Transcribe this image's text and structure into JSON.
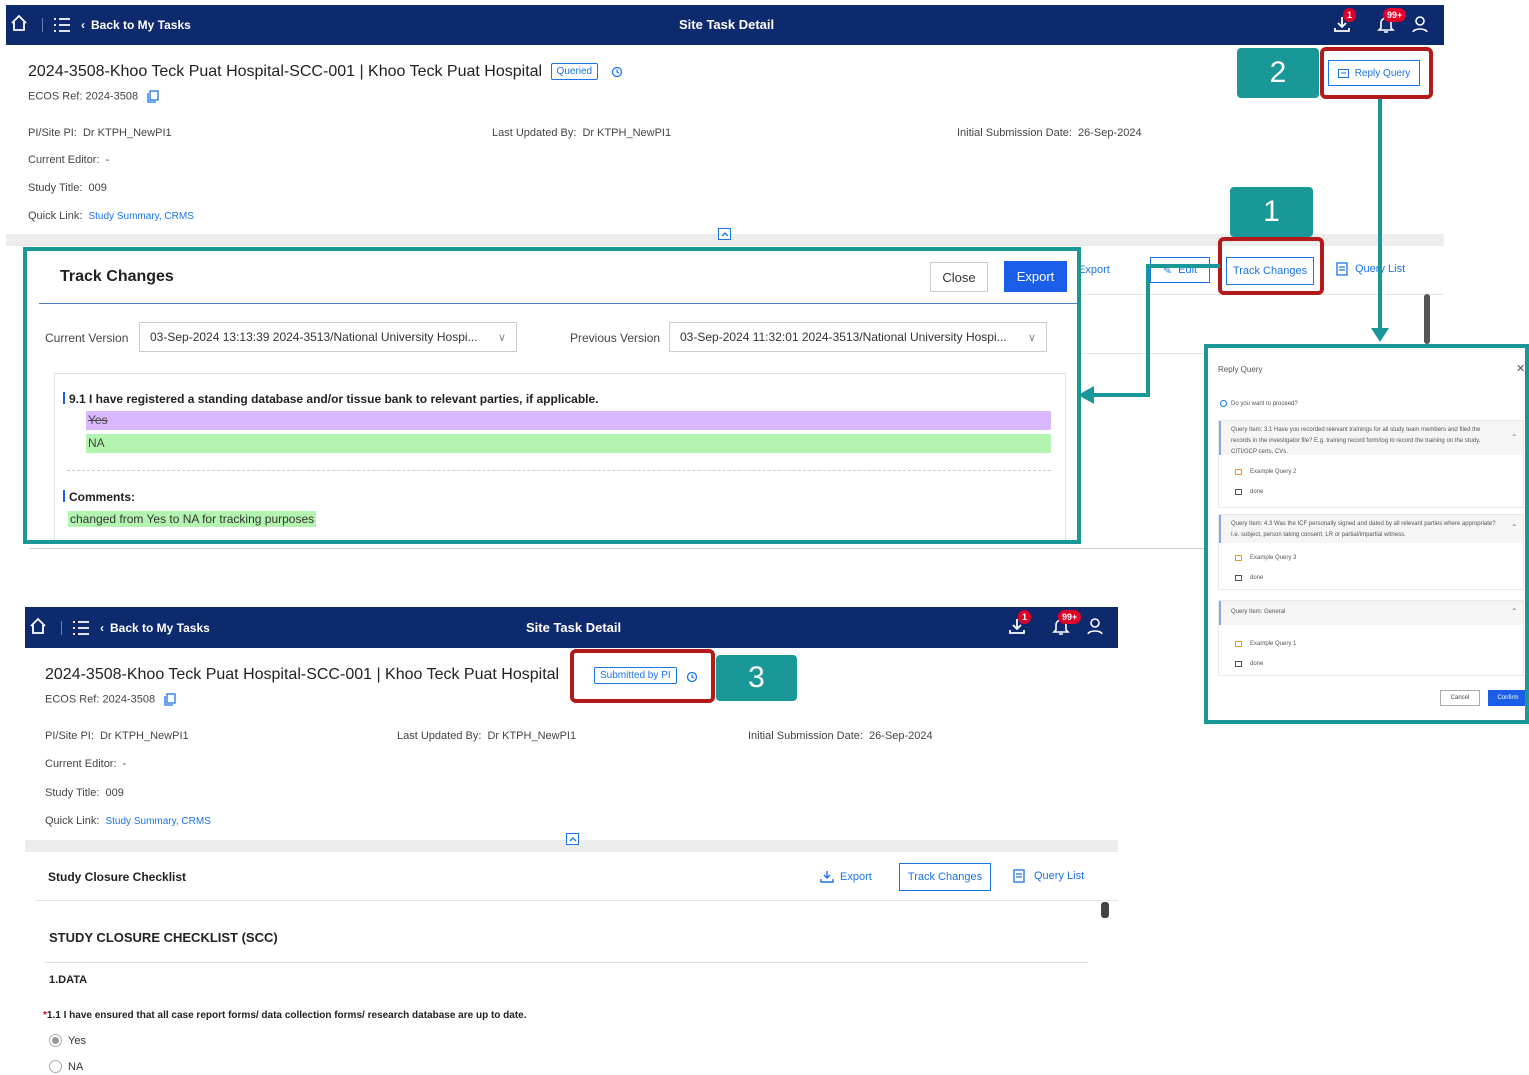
{
  "top_screen": {
    "nav": {
      "back_label": "Back to My Tasks",
      "title": "Site Task Detail",
      "download_badge": "1",
      "bell_badge": "99+"
    },
    "task_title": "2024-3508-Khoo Teck Puat Hospital-SCC-001 | Khoo Teck Puat Hospital",
    "status_tag": "Queried",
    "ecos_ref": "ECOS Ref: 2024-3508",
    "pi_label": "PI/Site PI:",
    "pi_value": "Dr KTPH_NewPI1",
    "last_updated_label": "Last Updated By:",
    "last_updated_value": "Dr KTPH_NewPI1",
    "submission_label": "Initial Submission Date:",
    "submission_value": "26-Sep-2024",
    "editor_label": "Current Editor:",
    "editor_value": "-",
    "study_title_label": "Study Title:",
    "study_title_value": "009",
    "quick_link_label": "Quick Link:",
    "quick_link_value": "Study Summary, CRMS",
    "reply_query_label": "Reply Query",
    "toolbar": {
      "export": "Export",
      "edit": "Edit",
      "track_changes": "Track Changes",
      "query_list": "Query List"
    }
  },
  "track_changes": {
    "title": "Track Changes",
    "close_label": "Close",
    "export_label": "Export",
    "current_version_label": "Current Version",
    "current_version_value": "03-Sep-2024 13:13:39 2024-3513/National University Hospi...",
    "previous_version_label": "Previous Version",
    "previous_version_value": "03-Sep-2024 11:32:01 2024-3513/National University Hospi...",
    "question": "9.1 I have registered a standing database and/or tissue bank to relevant parties, if applicable.",
    "removed_value": "Yes",
    "added_value": "NA",
    "comments_label": "Comments:",
    "comment_text": "changed from Yes to NA for tracking purposes"
  },
  "reply_query": {
    "title": "Reply Query",
    "proceed": "Do you want to proceed?",
    "items": [
      {
        "header": "Query Item: 3.1 Have you recorded relevant trainings for all study team members and filed the records in the investigator file? E.g. training record form/log to record the training on the study, CITI/GCP certs, CVs.",
        "query": "Example Query 2",
        "reply": "done"
      },
      {
        "header": "Query Item: 4.3 Was the ICF personally signed and dated by all relevant parties where appropriate? I.e. subject, person taking consent, LR or partial/impartial witness.",
        "query": "Example Query 3",
        "reply": "done"
      },
      {
        "header": "Query Item: General",
        "query": "Example Query 1",
        "reply": "done"
      }
    ],
    "cancel_label": "Cancel",
    "confirm_label": "Confirm"
  },
  "bottom_screen": {
    "nav": {
      "back_label": "Back to My Tasks",
      "title": "Site Task Detail",
      "download_badge": "1",
      "bell_badge": "99+"
    },
    "task_title": "2024-3508-Khoo Teck Puat Hospital-SCC-001 | Khoo Teck Puat Hospital",
    "status_tag": "Submitted by PI",
    "ecos_ref": "ECOS Ref: 2024-3508",
    "pi_label": "PI/Site PI:",
    "pi_value": "Dr KTPH_NewPI1",
    "last_updated_label": "Last Updated By:",
    "last_updated_value": "Dr KTPH_NewPI1",
    "submission_label": "Initial Submission Date:",
    "submission_value": "26-Sep-2024",
    "editor_label": "Current Editor:",
    "editor_value": "-",
    "study_title_label": "Study Title:",
    "study_title_value": "009",
    "quick_link_label": "Quick Link:",
    "quick_link_value": "Study Summary, CRMS",
    "section_title": "Study Closure Checklist",
    "toolbar": {
      "export": "Export",
      "track_changes": "Track Changes",
      "query_list": "Query List"
    },
    "checklist_heading": "STUDY CLOSURE CHECKLIST (SCC)",
    "data_heading": "1.DATA",
    "q1_marker": "*",
    "q1": "1.1 I have ensured that all case report forms/ data collection forms/ research database are up to date.",
    "options": [
      "Yes",
      "NA"
    ]
  },
  "step_badges": [
    "1",
    "2",
    "3"
  ],
  "colors": {
    "nav": "#0e2a6e",
    "teal": "#1a9898",
    "red": "#b51a1a",
    "removed": "#d9b8ff",
    "added": "#b3f5b0",
    "primary": "#1a5ee8"
  }
}
